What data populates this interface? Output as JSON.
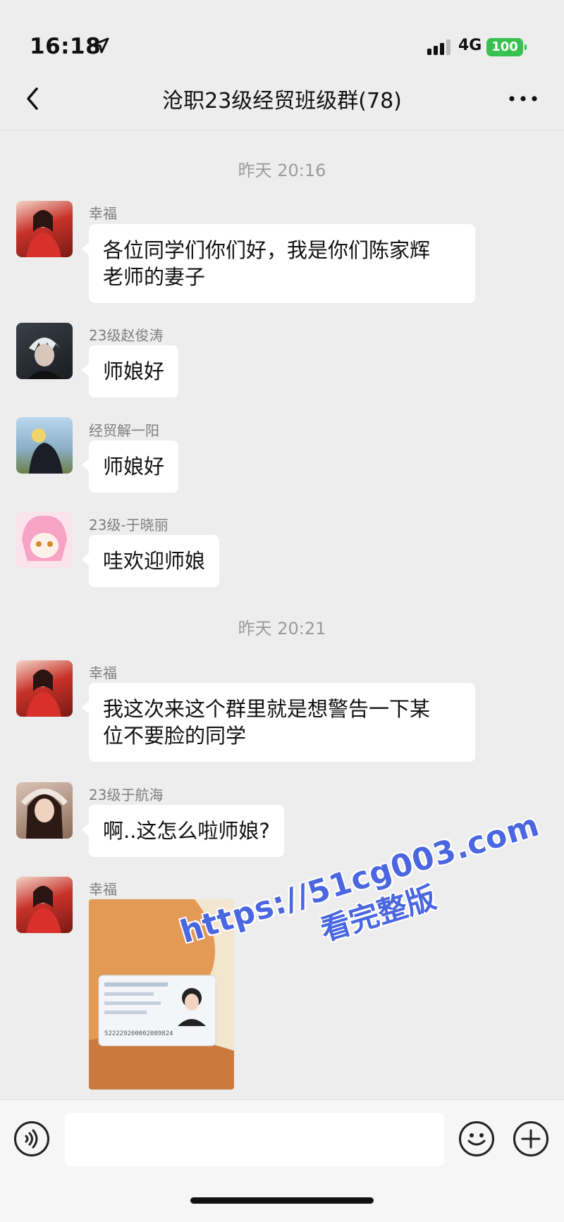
{
  "status_bar": {
    "time": "16:18",
    "network": "4G",
    "battery": "100"
  },
  "nav": {
    "title": "沧职23级经贸班级群(78)"
  },
  "messages": [
    {
      "type": "timestamp",
      "text": "昨天 20:16"
    },
    {
      "type": "text",
      "sender": "幸福",
      "text_lines": [
        "各位同学们你们好，我是你们陈家辉",
        "老师的妻子"
      ]
    },
    {
      "type": "text",
      "sender": "23级赵俊涛",
      "text": "师娘好"
    },
    {
      "type": "text",
      "sender": "经贸解一阳",
      "text": "师娘好"
    },
    {
      "type": "text",
      "sender": "23级-于晓丽",
      "text": "哇欢迎师娘"
    },
    {
      "type": "timestamp",
      "text": "昨天 20:21"
    },
    {
      "type": "text",
      "sender": "幸福",
      "text_lines": [
        "我这次来这个群里就是想警告一下某",
        "位不要脸的同学"
      ]
    },
    {
      "type": "text",
      "sender": "23级于航海",
      "text": "啊..这怎么啦师娘?"
    },
    {
      "type": "image",
      "sender": "幸福",
      "id_card_number": "522229200002089824"
    }
  ],
  "input": {
    "value": ""
  },
  "watermark": {
    "url": "https://51cg003.com",
    "subtitle": "看完整版"
  },
  "colors": {
    "background": "#ededed",
    "bubble": "#ffffff",
    "battery": "#38c14f",
    "watermark": "#4a66e0"
  }
}
